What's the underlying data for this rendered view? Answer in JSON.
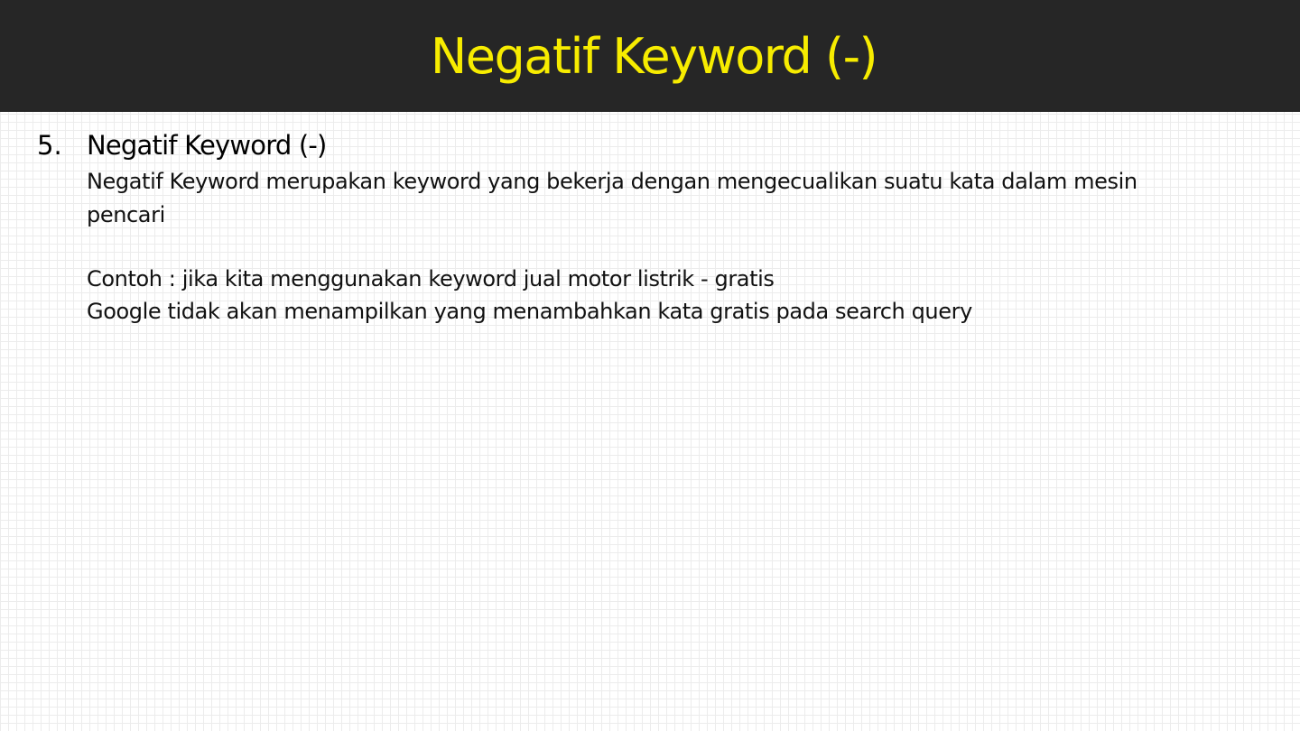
{
  "slide": {
    "title": "Negatif Keyword (-)",
    "title_color": "#f7ec00",
    "header_background": "#262626"
  },
  "item": {
    "number": "5.",
    "heading": "Negatif Keyword (-)",
    "lines": [
      "Negatif Keyword merupakan keyword yang bekerja dengan mengecualikan suatu kata dalam mesin",
      "pencari",
      "Contoh : jika kita menggunakan keyword jual motor listrik - gratis",
      "Google tidak akan menampilkan yang menambahkan kata gratis pada search query"
    ]
  }
}
